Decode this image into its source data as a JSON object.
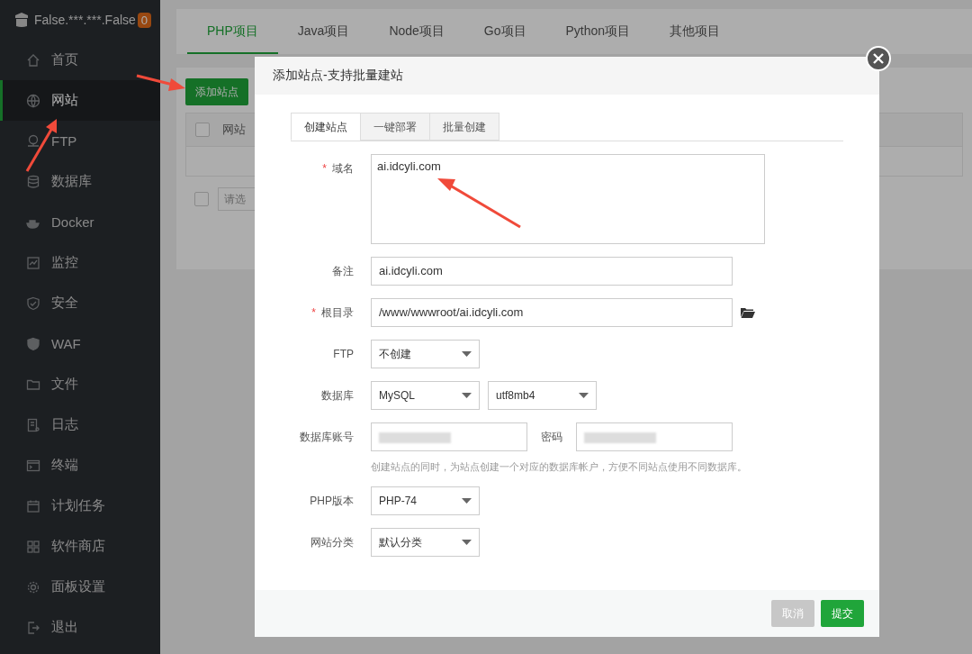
{
  "sidebar": {
    "brand": "False.***.***.False",
    "badge": "0",
    "items": [
      {
        "label": "首页",
        "selected": false
      },
      {
        "label": "网站",
        "selected": true
      },
      {
        "label": "FTP",
        "selected": false
      },
      {
        "label": "数据库",
        "selected": false
      },
      {
        "label": "Docker",
        "selected": false
      },
      {
        "label": "监控",
        "selected": false
      },
      {
        "label": "安全",
        "selected": false
      },
      {
        "label": "WAF",
        "selected": false
      },
      {
        "label": "文件",
        "selected": false
      },
      {
        "label": "日志",
        "selected": false
      },
      {
        "label": "终端",
        "selected": false
      },
      {
        "label": "计划任务",
        "selected": false
      },
      {
        "label": "软件商店",
        "selected": false
      },
      {
        "label": "面板设置",
        "selected": false
      },
      {
        "label": "退出",
        "selected": false
      }
    ]
  },
  "tabs": [
    {
      "label": "PHP项目",
      "selected": true
    },
    {
      "label": "Java项目",
      "selected": false
    },
    {
      "label": "Node项目",
      "selected": false
    },
    {
      "label": "Go项目",
      "selected": false
    },
    {
      "label": "Python项目",
      "selected": false
    },
    {
      "label": "其他项目",
      "selected": false
    }
  ],
  "add_button": "添加站点",
  "table": {
    "select_all_checked": false,
    "columns": [
      "网站"
    ]
  },
  "batch_select": {
    "checked": false,
    "placeholder": "请选"
  },
  "dialog": {
    "title": "添加站点-支持批量建站",
    "tabs": [
      {
        "label": "创建站点",
        "selected": true
      },
      {
        "label": "一键部署",
        "selected": false
      },
      {
        "label": "批量创建",
        "selected": false
      }
    ],
    "rows": [
      {
        "label": "域名",
        "required_mark": "*",
        "controls": [
          {
            "kind": "textarea",
            "value": "ai.idcyli.com"
          }
        ]
      },
      {
        "label": "备注",
        "controls": [
          {
            "kind": "input",
            "value": "ai.idcyli.com"
          }
        ]
      },
      {
        "label": "根目录",
        "required_mark": "*",
        "controls": [
          {
            "kind": "input",
            "value": "/www/wwwroot/ai.idcyli.com"
          },
          {
            "kind": "folder"
          }
        ]
      },
      {
        "label": "FTP",
        "controls": [
          {
            "kind": "select",
            "value": "不创建"
          }
        ]
      },
      {
        "label": "数据库",
        "controls": [
          {
            "kind": "select",
            "value": "MySQL"
          },
          {
            "kind": "select",
            "value": "utf8mb4"
          }
        ]
      },
      {
        "label": "数据库账号",
        "controls": [
          {
            "kind": "secret"
          },
          {
            "kind": "label",
            "text": "密码"
          },
          {
            "kind": "secret"
          }
        ],
        "hint": "创建站点的同时，为站点创建一个对应的数据库帐户，方便不同站点使用不同数据库。"
      },
      {
        "label": "PHP版本",
        "controls": [
          {
            "kind": "select",
            "value": "PHP-74"
          }
        ]
      },
      {
        "label": "网站分类",
        "controls": [
          {
            "kind": "select",
            "value": "默认分类"
          }
        ]
      }
    ],
    "buttons": [
      {
        "label": "取消",
        "kind": "cancel"
      },
      {
        "label": "提交",
        "kind": "primary"
      }
    ]
  }
}
